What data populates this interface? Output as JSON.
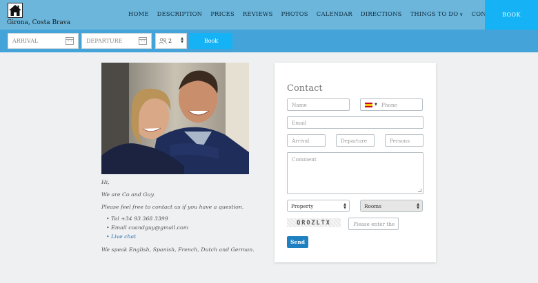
{
  "header": {
    "site_name": "Girona, Costa Brava",
    "nav": [
      {
        "label": "HOME"
      },
      {
        "label": "DESCRIPTION"
      },
      {
        "label": "PRICES"
      },
      {
        "label": "REVIEWS"
      },
      {
        "label": "PHOTOS"
      },
      {
        "label": "CALENDAR"
      },
      {
        "label": "DIRECTIONS"
      },
      {
        "label": "THINGS TO DO"
      },
      {
        "label": "CONTACT"
      }
    ],
    "book_label": "BOOK"
  },
  "booking_bar": {
    "arrival_placeholder": "ARRIVAL",
    "departure_placeholder": "DEPARTURE",
    "guests_value": "2",
    "book_label": "Book"
  },
  "intro": {
    "greeting": "Hi,",
    "line1": "We are Co and Guy.",
    "line2": "Please feel free to contact us if you have a question.",
    "contacts": [
      "Tel +34 93 368 3399",
      "Email coandguy@gmail.com",
      "Live chat"
    ],
    "languages": "We speak English, Spanish, French, Dutch and German."
  },
  "contact_form": {
    "title": "Contact",
    "name_placeholder": "Name",
    "phone_placeholder": "Phone",
    "email_placeholder": "Email",
    "arrival_placeholder": "Arrival",
    "departure_placeholder": "Departure",
    "persons_placeholder": "Persons",
    "comment_placeholder": "Comment",
    "property_select": "Property",
    "rooms_select": "Rooms",
    "captcha_text": "QROZLTX",
    "captcha_placeholder": "Please enter the",
    "send_label": "Send"
  },
  "colors": {
    "header_bg": "#6cb6dc",
    "bookbar_bg": "#44a3d8",
    "accent": "#15b3f5",
    "send_button": "#1e7fc1"
  }
}
